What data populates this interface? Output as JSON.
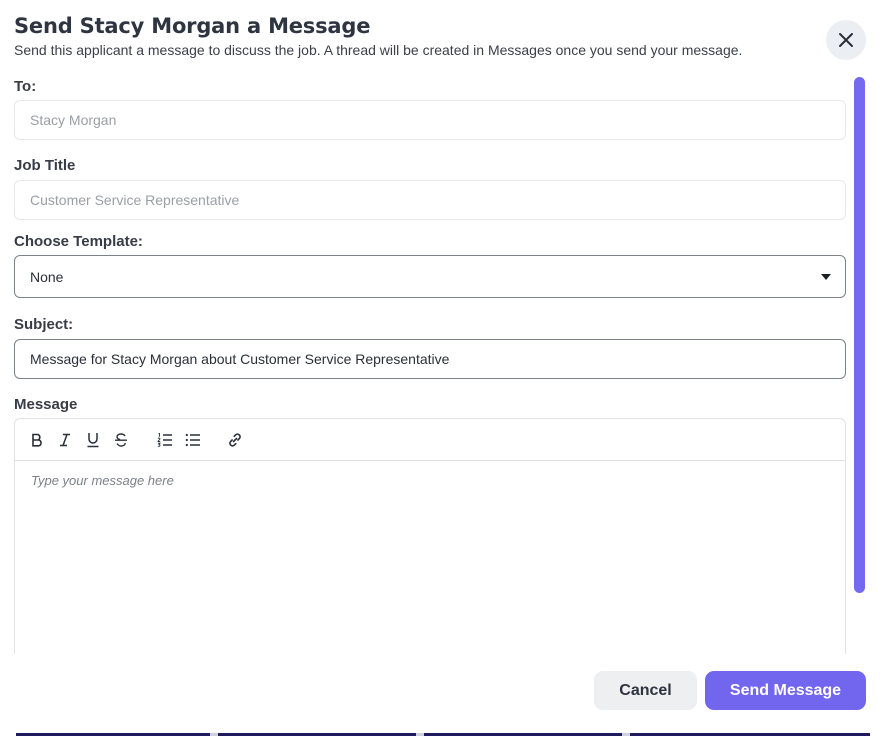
{
  "dialog": {
    "title": "Send Stacy Morgan a Message",
    "subtitle": "Send this applicant a message to discuss the job. A thread will be created in Messages once you send your message.",
    "close_icon": "close-icon"
  },
  "form": {
    "to": {
      "label": "To:",
      "value": "Stacy Morgan"
    },
    "job_title": {
      "label": "Job Title",
      "value": "Customer Service Representative"
    },
    "template": {
      "label": "Choose Template:",
      "selected": "None"
    },
    "subject": {
      "label": "Subject:",
      "value": "Message for Stacy Morgan about Customer Service Representative"
    },
    "message": {
      "label": "Message",
      "placeholder": "Type your message here",
      "toolbar": [
        "bold-icon",
        "italic-icon",
        "underline-icon",
        "strikethrough-icon",
        "ordered-list-icon",
        "bullet-list-icon",
        "link-icon"
      ]
    }
  },
  "footer": {
    "cancel_label": "Cancel",
    "send_label": "Send Message"
  },
  "colors": {
    "accent": "#7366ee",
    "scrollbar": "#7569ef",
    "cancel_bg": "#eeeff1"
  }
}
